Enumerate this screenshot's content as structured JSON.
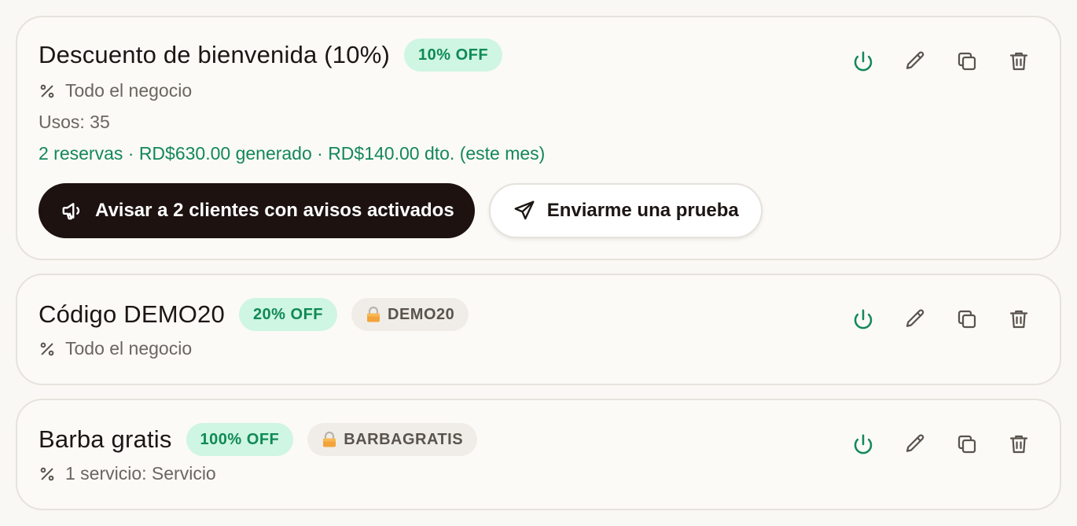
{
  "colors": {
    "accent_green": "#13875a",
    "pill_green_bg": "#cff5e3",
    "dark_button": "#1d1210"
  },
  "promotions": [
    {
      "title": "Descuento de bienvenida (10%)",
      "discount_badge": "10% OFF",
      "scope": "Todo el negocio",
      "usage": "Usos: 35",
      "stats": "2 reservas · RD$630.00 generado · RD$140.00 dto. (este mes)",
      "notify_button": "Avisar a 2 clientes con avisos activados",
      "test_button": "Enviarme una prueba"
    },
    {
      "title": "Código DEMO20",
      "discount_badge": "20% OFF",
      "code": "DEMO20",
      "scope": "Todo el negocio"
    },
    {
      "title": "Barba gratis",
      "discount_badge": "100% OFF",
      "code": "BARBAGRATIS",
      "scope": "1 servicio: Servicio"
    }
  ],
  "icons": {
    "percent": "percent-icon",
    "power": "power-icon",
    "edit": "pencil-icon",
    "duplicate": "copy-icon",
    "delete": "trash-icon",
    "megaphone": "megaphone-icon",
    "send": "send-icon",
    "lock": "lock-icon"
  }
}
